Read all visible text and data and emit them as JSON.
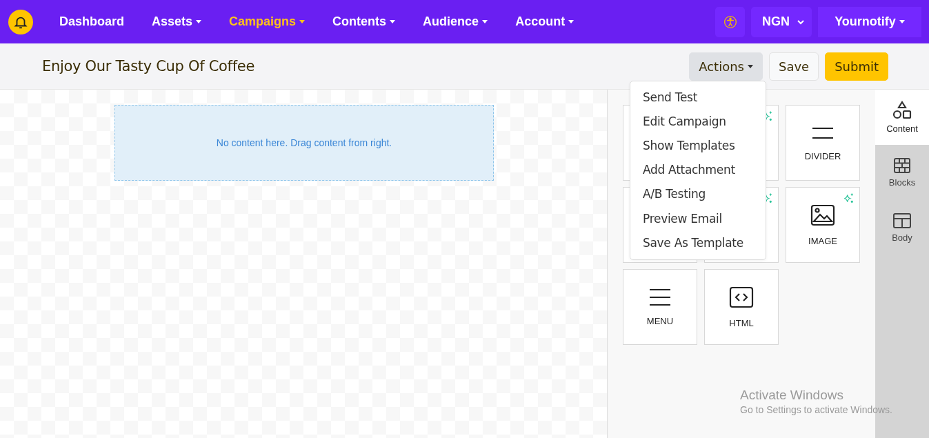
{
  "nav": {
    "items": [
      {
        "label": "Dashboard",
        "dropdown": false,
        "selected": false
      },
      {
        "label": "Assets",
        "dropdown": true,
        "selected": false
      },
      {
        "label": "Campaigns",
        "dropdown": true,
        "selected": true
      },
      {
        "label": "Contents",
        "dropdown": true,
        "selected": false
      },
      {
        "label": "Audience",
        "dropdown": true,
        "selected": false
      },
      {
        "label": "Account",
        "dropdown": true,
        "selected": false
      }
    ],
    "currency": "NGN",
    "account": "Yournotify"
  },
  "header": {
    "title": "Enjoy Our Tasty Cup Of Coffee",
    "buttons": [
      {
        "label": "Actions",
        "kind": "dropdown"
      },
      {
        "label": "Save",
        "kind": "plain"
      },
      {
        "label": "Submit",
        "kind": "primary"
      }
    ]
  },
  "actions_menu": [
    "Send Test",
    "Edit Campaign",
    "Show Templates",
    "Add Attachment",
    "A/B Testing",
    "Preview Email",
    "Save As Template"
  ],
  "canvas": {
    "placeholder_text": "No content here. Drag content from right."
  },
  "content_tiles": [
    {
      "ai": true
    },
    {
      "kind": "divider",
      "label": "DIVIDER",
      "ai": false
    },
    {
      "ai": true
    },
    {
      "kind": "image",
      "label": "IMAGE",
      "ai": true
    },
    {
      "kind": "menu",
      "label": "MENU",
      "ai": false
    },
    {
      "kind": "html",
      "label": "HTML",
      "ai": false
    }
  ],
  "side_tabs": [
    {
      "kind": "content",
      "label": "Content",
      "selected": true
    },
    {
      "kind": "blocks",
      "label": "Blocks",
      "selected": false
    },
    {
      "kind": "body",
      "label": "Body",
      "selected": false
    }
  ],
  "os_notice": {
    "title": "Activate Windows",
    "message": "Go to Settings to activate Windows."
  }
}
